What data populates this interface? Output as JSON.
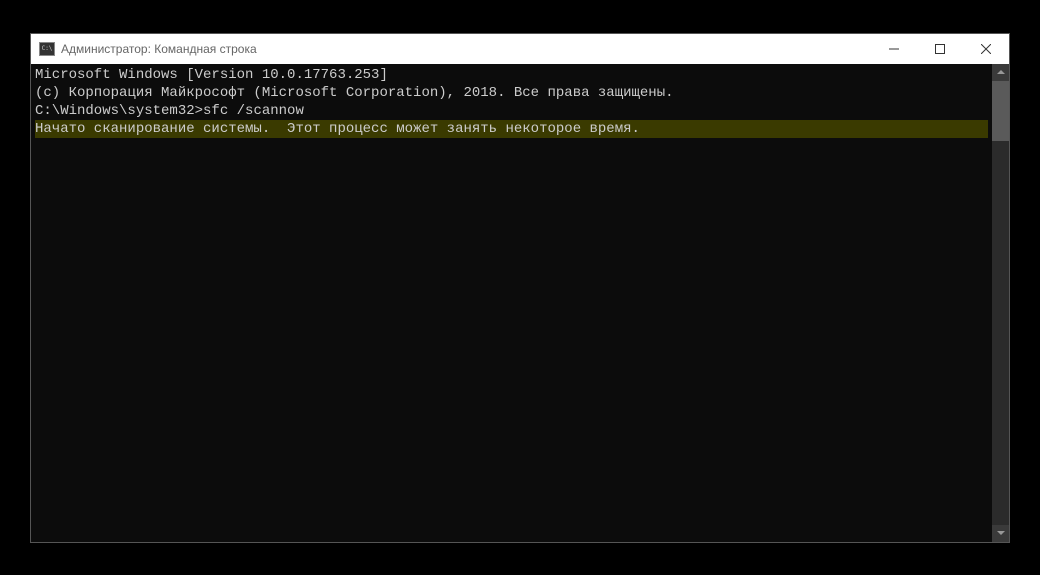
{
  "window": {
    "title": "Администратор: Командная строка"
  },
  "terminal": {
    "lines": {
      "l1": "Microsoft Windows [Version 10.0.17763.253]",
      "l2": "(c) Корпорация Майкрософт (Microsoft Corporation), 2018. Все права защищены.",
      "l3": "",
      "prompt": "C:\\Windows\\system32>",
      "command": "sfc /scannow",
      "l5": "",
      "l6": "Начато сканирование системы.  Этот процесс может занять некоторое время."
    }
  }
}
